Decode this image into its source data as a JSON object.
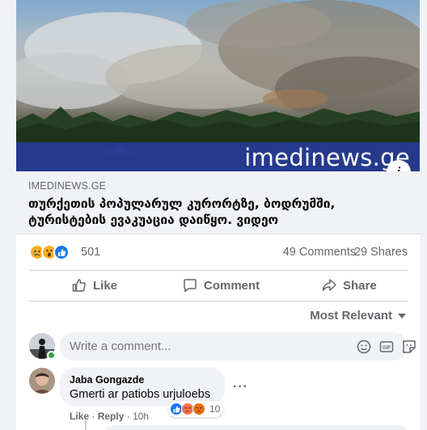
{
  "post": {
    "image_watermark": "imedinews.ge",
    "link_domain": "IMEDINEWS.GE",
    "link_title": "თურქეთის პოპულარულ კურორტზე, ბოდრუმში, ტურისტების ევაკუაცია დაიწყო. ვიდეო"
  },
  "stats": {
    "reaction_icons": [
      "sad-icon",
      "wow-icon",
      "like-icon"
    ],
    "reaction_count": "501",
    "comments": "49 Comments",
    "shares": "29 Shares"
  },
  "actions": {
    "like": "Like",
    "comment": "Comment",
    "share": "Share"
  },
  "sort": {
    "label": "Most Relevant"
  },
  "composer": {
    "placeholder": "Write a comment..."
  },
  "comments": [
    {
      "author": "Jaba Gongazde",
      "text": "Gmerti ar patiobs urjuloebs",
      "like_label": "Like",
      "reply_label": "Reply",
      "time": "10h",
      "reaction_icons": [
        "like-icon",
        "angry-icon",
        "angry-icon"
      ],
      "reaction_count": "10"
    }
  ],
  "colors": {
    "brand_blue": "#1877f2",
    "secondary_text": "#65676b",
    "bubble_bg": "#f0f2f5",
    "online": "#31a24c"
  }
}
